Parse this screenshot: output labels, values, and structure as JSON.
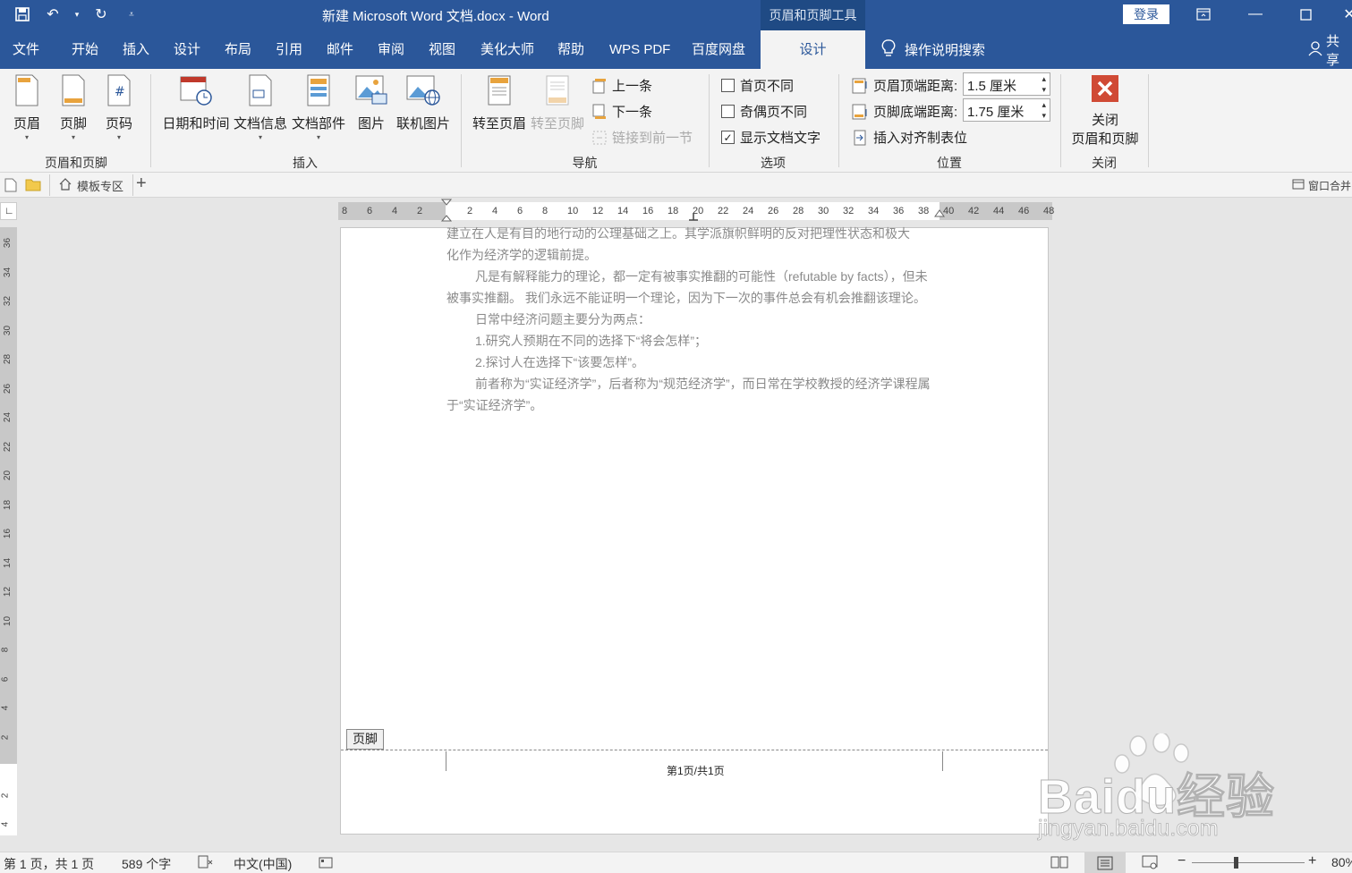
{
  "titlebar": {
    "title": "新建 Microsoft Word 文档.docx  -  Word",
    "context_tools": "页眉和页脚工具",
    "login": "登录"
  },
  "tabs": [
    "文件",
    "开始",
    "插入",
    "设计",
    "布局",
    "引用",
    "邮件",
    "审阅",
    "视图",
    "美化大师",
    "帮助",
    "WPS PDF",
    "百度网盘",
    "设计"
  ],
  "search": "操作说明搜索",
  "share": "共享",
  "ribbon": {
    "group1": {
      "label": "页眉和页脚",
      "buttons": [
        "页眉",
        "页脚",
        "页码"
      ]
    },
    "group2": {
      "label": "插入",
      "buttons": [
        "日期和时间",
        "文档信息",
        "文档部件",
        "图片",
        "联机图片"
      ]
    },
    "group3": {
      "label": "导航",
      "goto_header": "转至页眉",
      "goto_footer": "转至页脚",
      "prev": "上一条",
      "next": "下一条",
      "link_prev": "链接到前一节"
    },
    "group4": {
      "label": "选项",
      "diff_first": "首页不同",
      "diff_odd_even": "奇偶页不同",
      "show_text": "显示文档文字",
      "show_text_checked": true
    },
    "group5": {
      "label": "位置",
      "header_from_top": "页眉顶端距离:",
      "header_value": "1.5 厘米",
      "footer_from_bottom": "页脚底端距离:",
      "footer_value": "1.75 厘米",
      "insert_tab": "插入对齐制表位"
    },
    "group6": {
      "label": "关闭",
      "close_line1": "关闭",
      "close_line2": "页眉和页脚"
    }
  },
  "filebar": {
    "template": "模板专区",
    "window_merge": "窗口合并"
  },
  "hruler_ticks": [
    "8",
    "6",
    "4",
    "2",
    "",
    "2",
    "4",
    "6",
    "8",
    "10",
    "12",
    "14",
    "16",
    "18",
    "20",
    "22",
    "24",
    "26",
    "28",
    "30",
    "32",
    "34",
    "36",
    "38",
    "40",
    "42",
    "44",
    "46",
    "48"
  ],
  "vruler_ticks": [
    "36",
    "34",
    "32",
    "30",
    "28",
    "26",
    "24",
    "22",
    "20",
    "18",
    "16",
    "14",
    "12",
    "10",
    "8",
    "6",
    "4",
    "2",
    "",
    "2",
    "4"
  ],
  "document": {
    "paragraphs": [
      "建立在人是有目的地行动的公理基础之上。其学派旗帜鲜明的反对把理性状态和极大",
      "化作为经济学的逻辑前提。",
      "凡是有解释能力的理论，都一定有被事实推翻的可能性（refutable by facts），但未",
      "被事实推翻。 我们永远不能证明一个理论，因为下一次的事件总会有机会推翻该理论。",
      "日常中经济问题主要分为两点：",
      "1.研究人预期在不同的选择下“将会怎样”；",
      "2.探讨人在选择下“该要怎样”。",
      "前者称为“实证经济学”，后者称为“规范经济学”，而日常在学校教授的经济学课程属",
      "于“实证经济学”。"
    ],
    "footer_tag": "页脚",
    "footer_text": "第1页/共1页"
  },
  "status": {
    "page": "第 1 页，共 1 页",
    "words": "589 个字",
    "lang": "中文(中国)",
    "zoom": "80%"
  },
  "watermark": {
    "brand": "Baidu经验",
    "url": "jingyan.baidu.com"
  }
}
